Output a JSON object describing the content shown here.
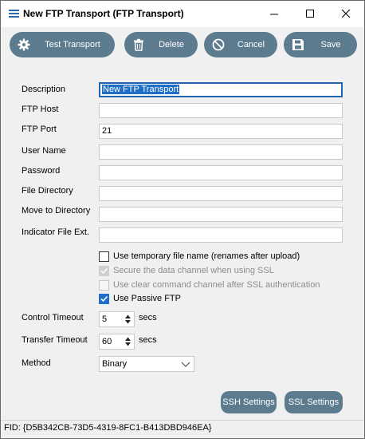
{
  "window": {
    "title": "New FTP Transport (FTP Transport)"
  },
  "toolbar": {
    "test_label": "Test Transport",
    "delete_label": "Delete",
    "cancel_label": "Cancel",
    "save_label": "Save"
  },
  "form": {
    "description": {
      "label": "Description",
      "value": "New FTP Transport"
    },
    "ftp_host": {
      "label": "FTP Host",
      "value": ""
    },
    "ftp_port": {
      "label": "FTP Port",
      "value": "21"
    },
    "user_name": {
      "label": "User Name",
      "value": ""
    },
    "password": {
      "label": "Password",
      "value": ""
    },
    "file_directory": {
      "label": "File Directory",
      "value": ""
    },
    "move_to_directory": {
      "label": "Move to Directory",
      "value": ""
    },
    "indicator_file_ext": {
      "label": "Indicator File Ext.",
      "value": ""
    }
  },
  "options": {
    "temp_name": {
      "label": "Use temporary file name (renames after upload)",
      "checked": false,
      "enabled": true
    },
    "secure_data": {
      "label": "Secure the data channel when using SSL",
      "checked": true,
      "enabled": false
    },
    "clear_command": {
      "label": "Use clear command channel after SSL authentication",
      "checked": false,
      "enabled": false
    },
    "passive": {
      "label": "Use Passive FTP",
      "checked": true,
      "enabled": true
    }
  },
  "timeouts": {
    "control": {
      "label": "Control Timeout",
      "value": "5",
      "unit": "secs"
    },
    "transfer": {
      "label": "Transfer Timeout",
      "value": "60",
      "unit": "secs"
    }
  },
  "method": {
    "label": "Method",
    "value": "Binary"
  },
  "buttons": {
    "ssh_label": "SSH Settings",
    "ssl_label": "SSL Settings"
  },
  "status": {
    "fid": "FID: {D5B342CB-73D5-4319-8FC1-B413DBD946EA}"
  },
  "colors": {
    "button_bg": "#5d7b8f",
    "focus_blue": "#1f64b0",
    "check_blue": "#1f6fc8"
  },
  "icons": {
    "app": "menu-lines-icon",
    "test": "gear-icon",
    "delete": "trash-icon",
    "cancel": "no-entry-icon",
    "save": "floppy-disk-icon"
  }
}
